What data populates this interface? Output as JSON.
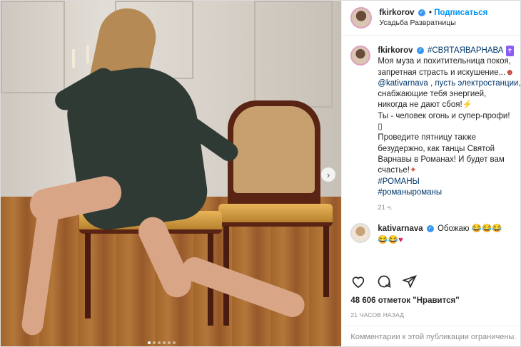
{
  "post": {
    "username": "fkirkorov",
    "follow_label": "Подписаться",
    "location": "Усадьба Развратницы",
    "caption": {
      "headline": "#СВЯТАЯВАРНАВА",
      "lines": [
        "Моя муза и похитительница покоя,",
        "запретная страсть и искушение...",
        "@kativarnava , пусть электростанции,",
        "снабжающие тебя энергией,",
        "никогда не дают сбоя!",
        "Ты - человек огонь и супер-профи!",
        "",
        "Проведите пятницу также",
        "безудержно, как танцы Святой",
        "Варнавы в Романах! И будет вам",
        "счастье!"
      ],
      "tag1": "#РОМАНЫ",
      "tag2": "#романыроманы",
      "time": "21 ч."
    },
    "comment": {
      "username": "kativarnava",
      "text": "Обожаю"
    },
    "likes": "48 606 отметок \"Нравится\"",
    "timestamp": "21 ЧАСОВ НАЗАД",
    "comment_placeholder": "Комментарии к этой публикации ограничены."
  },
  "icons": {
    "like": "heart-icon",
    "comment": "comment-icon",
    "share": "send-icon",
    "verified": "verified-badge-icon"
  },
  "colors": {
    "link": "#0095f6",
    "hashtag": "#00376b",
    "muted": "#8e8e8e"
  }
}
